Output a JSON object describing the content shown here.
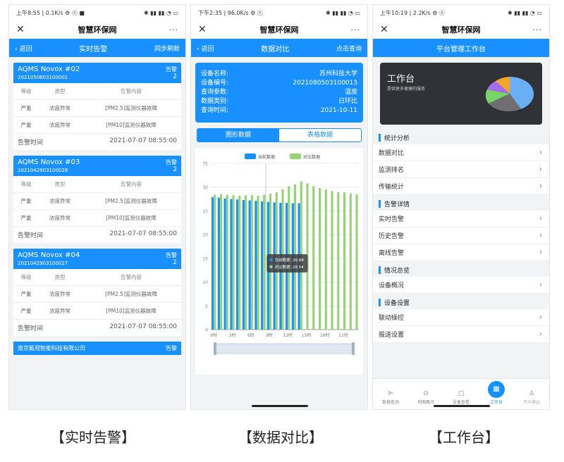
{
  "phone1": {
    "status_left": "上午8:55 | 0.1K/s ⚙ ⓔ ■",
    "status_right": "✱ ▮▮ ▮▮ ◔ ▭",
    "title": "智慧环保网",
    "nav": {
      "back": "‹ 返回",
      "title": "实时告警",
      "right": "同步刷新"
    },
    "columns": [
      "等级",
      "类型",
      "告警内容"
    ],
    "time_label": "告警时间",
    "alarms": [
      {
        "name": "AQMS Novox #02",
        "code": "2021050603100001",
        "badge": "告警",
        "count": "2",
        "rows": [
          [
            "严重",
            "浓度异常",
            "[PM2.5]监测仪器故障"
          ],
          [
            "严重",
            "浓度异常",
            "[PM10]监测仪器故障"
          ]
        ],
        "time": "2021-07-07 08:55:00"
      },
      {
        "name": "AQMS Novox #03",
        "code": "2021042903100028",
        "badge": "告警",
        "count": "2",
        "rows": [
          [
            "严重",
            "浓度异常",
            "[PM2.5]监测仪器故障"
          ],
          [
            "严重",
            "浓度异常",
            "[PM10]监测仪器故障"
          ]
        ],
        "time": "2021-07-07 08:55:00"
      },
      {
        "name": "AQMS Novox #04",
        "code": "2021042903100027",
        "badge": "告警",
        "count": "2",
        "rows": [
          [
            "严重",
            "浓度异常",
            "[PM2.5]监测仪器故障"
          ],
          [
            "严重",
            "浓度异常",
            "[PM10]监测仪器故障"
          ]
        ],
        "time": "2021-07-07 08:55:00"
      }
    ],
    "stub": {
      "name": "南京甄视智能科技有限公司",
      "badge": "告警"
    },
    "caption": "【实时告警】"
  },
  "phone2": {
    "status_left": "下午2:35 | 96.0K/s ⚙ ⓔ",
    "status_right": "✱ ▮▮ ▮▮ ◔ ▭",
    "title": "智慧环保网",
    "nav": {
      "back": "‹ 返回",
      "title": "数据对比",
      "right": "点击查询"
    },
    "info": [
      {
        "k": "设备名称:",
        "v": "苏州科技大学"
      },
      {
        "k": "设备编号:",
        "v": "2021080503100013"
      },
      {
        "k": "查询参数:",
        "v": "温度"
      },
      {
        "k": "数据类别:",
        "v": "日环比"
      },
      {
        "k": "查询时间:",
        "v": "2021-10-11"
      }
    ],
    "seg_left": "图形数据",
    "seg_right": "表格数据",
    "tooltip": {
      "line1": "当前数据: 26.68",
      "line2": "对比数据: 28.54"
    },
    "caption": "【数据对比】"
  },
  "chart_data": {
    "type": "bar",
    "categories": [
      "0时",
      "1时",
      "2时",
      "3时",
      "4时",
      "5时",
      "6时",
      "7时",
      "8时",
      "9时",
      "10时",
      "11时",
      "12时",
      "13时",
      "14时",
      "15时",
      "16时",
      "17时",
      "18时",
      "19时",
      "20时",
      "21时",
      "22时",
      "23时"
    ],
    "tick_labels": [
      "0时",
      "3时",
      "6时",
      "9时",
      "12时",
      "15时",
      "18时",
      "21时"
    ],
    "series": [
      {
        "name": "当前数据",
        "color": "#1890ff",
        "values": [
          27.9,
          27.8,
          27.6,
          27.5,
          27.4,
          27.3,
          27.2,
          27.1,
          27.0,
          26.9,
          26.8,
          26.7,
          26.68,
          26.6,
          26.6,
          null,
          null,
          null,
          null,
          null,
          null,
          null,
          null,
          null
        ]
      },
      {
        "name": "对比数据",
        "color": "#95d475",
        "values": [
          28.4,
          28.5,
          28.4,
          28.3,
          28.2,
          28.3,
          28.3,
          28.2,
          28.4,
          28.6,
          28.9,
          29.6,
          30.2,
          30.6,
          31.2,
          30.8,
          30.2,
          29.8,
          29.5,
          29.2,
          29.0,
          28.9,
          28.7,
          28.5
        ]
      }
    ],
    "yticks": [
      0,
      5,
      10,
      15,
      20,
      25,
      30,
      35
    ],
    "ylim": [
      0,
      35
    ],
    "legend_position": "top-center",
    "grid": true
  },
  "phone3": {
    "status_left": "上午10:19 | 2.2K/s ⚙ ⓔ",
    "status_right": "✱ ▮▮ ▮▮ ◔ ▭",
    "title": "智慧环保网",
    "nav_title": "平台管理工作台",
    "workbench_title": "工作台",
    "workbench_sub": "提供更多便捷的服务",
    "sections": [
      {
        "title": "统计分析",
        "items": [
          "数据对比",
          "监测排名",
          "传输统计"
        ]
      },
      {
        "title": "告警详情",
        "items": [
          "实时告警",
          "历史告警",
          "离线告警"
        ]
      },
      {
        "title": "情况总览",
        "items": [
          "设备概况"
        ]
      },
      {
        "title": "设备设置",
        "items": [
          "联动操控",
          "报送设置"
        ]
      }
    ],
    "tabs": [
      {
        "icon": "⊫",
        "label": "数据查询"
      },
      {
        "icon": "⊙",
        "label": "地图概况"
      },
      {
        "icon": "▢",
        "label": "设备查看"
      },
      {
        "icon": "▦",
        "label": "工作台"
      },
      {
        "icon": "♙",
        "label": "个人中心"
      }
    ],
    "caption": "【工作台】"
  },
  "colors": {
    "primary": "#1890ff",
    "compare": "#95d475",
    "dark_card": "#2f3236"
  }
}
